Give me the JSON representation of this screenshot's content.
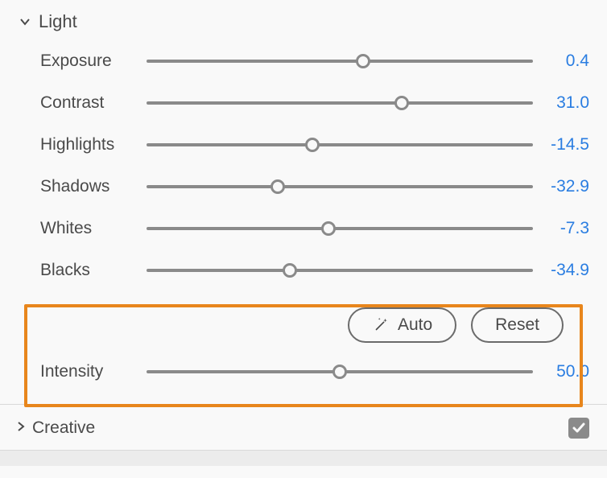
{
  "sections": {
    "light": {
      "title": "Light",
      "expanded": true,
      "sliders": [
        {
          "label": "Exposure",
          "value": "0.4",
          "pos": 56
        },
        {
          "label": "Contrast",
          "value": "31.0",
          "pos": 66
        },
        {
          "label": "Highlights",
          "value": "-14.5",
          "pos": 43
        },
        {
          "label": "Shadows",
          "value": "-32.9",
          "pos": 34
        },
        {
          "label": "Whites",
          "value": "-7.3",
          "pos": 47
        },
        {
          "label": "Blacks",
          "value": "-34.9",
          "pos": 37
        }
      ]
    },
    "intensity": {
      "label": "Intensity",
      "value": "50.0",
      "pos": 50
    },
    "buttons": {
      "auto": "Auto",
      "reset": "Reset"
    },
    "creative": {
      "title": "Creative",
      "expanded": false,
      "checked": true
    }
  }
}
